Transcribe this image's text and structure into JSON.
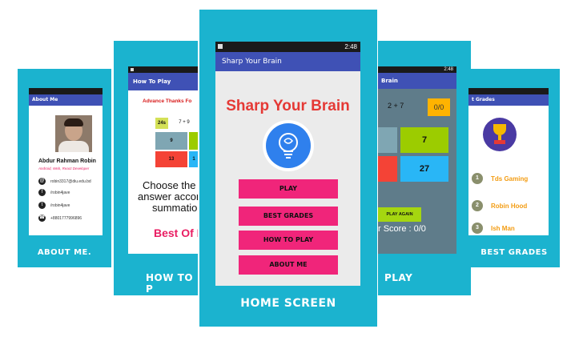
{
  "colors": {
    "card_bg": "#1bb3cf",
    "appbar": "#3f51b5",
    "accent_pink": "#f0257a",
    "title_red": "#e53935"
  },
  "about": {
    "app_title": "About Me",
    "name": "Abdur Rahman Robin",
    "role": "Android, Web, React Developer",
    "email": "robin3317@diu.edu.bd",
    "facebook": "/robin4jave",
    "twitter": "/robin4jave",
    "phone": "+8801777996896",
    "label": "ABOUT ME."
  },
  "howto": {
    "app_title": "How To Play",
    "advance": "Advance Thanks Fo",
    "cells": [
      "24s",
      "7 + 9",
      "9",
      "",
      "13",
      "1"
    ],
    "text_lines": [
      "Choose the co",
      "answer accord",
      "summatio"
    ],
    "best": "Best Of L",
    "label": "HOW TO P"
  },
  "home": {
    "status_time": "2:48",
    "app_title": "Sharp Your Brain",
    "title": "Sharp Your Brain",
    "buttons": [
      "PLAY",
      "BEST GRADES",
      "HOW TO PLAY",
      "ABOUT ME"
    ],
    "label": "HOME SCREEN",
    "icon": "brain-lightbulb-icon"
  },
  "play": {
    "status_time": "2:48",
    "app_title": "Brain",
    "question": "2 + 7",
    "score_box": "0/0",
    "cells": [
      "7",
      "27"
    ],
    "play_again": "PLAY AGAIN",
    "your_score": "r Score : 0/0",
    "label": "PLAY"
  },
  "best": {
    "app_title": "t Grades",
    "rows": [
      {
        "rank": "1",
        "name": "Tds Gaming"
      },
      {
        "rank": "2",
        "name": "Robin Hood"
      },
      {
        "rank": "3",
        "name": "Ish Man"
      }
    ],
    "label": "BEST GRADES"
  }
}
